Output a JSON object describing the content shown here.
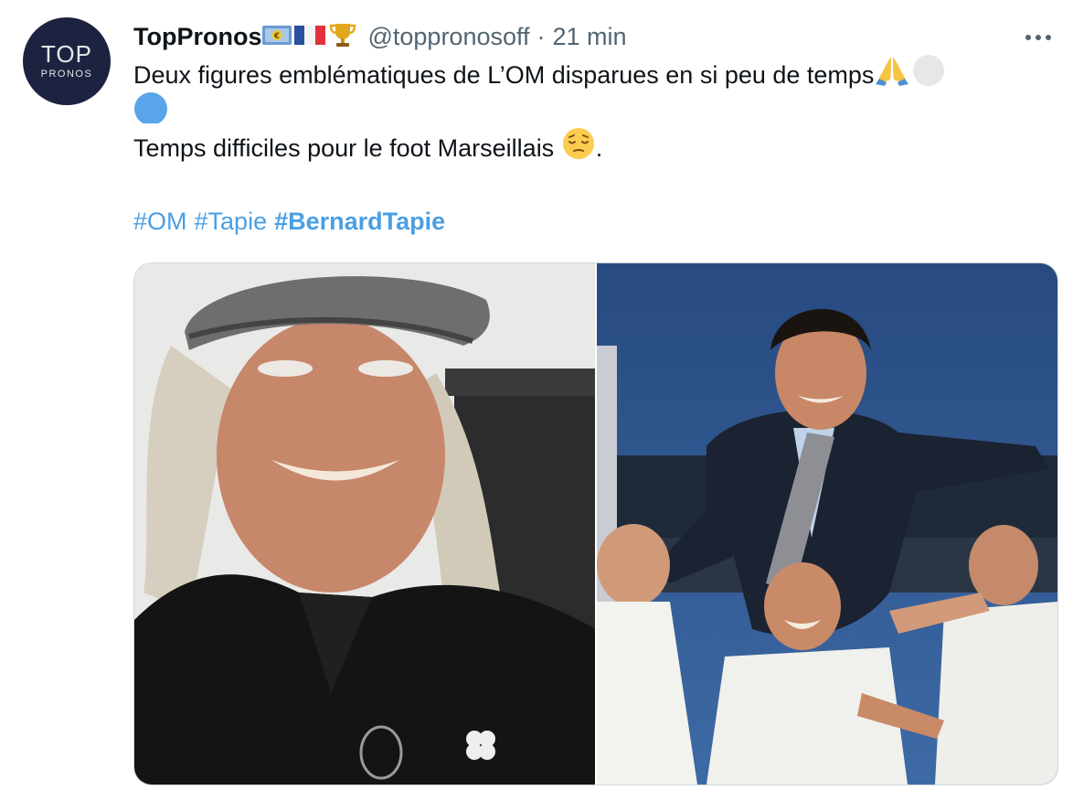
{
  "author": {
    "avatar_line1": "TOP",
    "avatar_line2": "PRONOS",
    "display_name": "TopPronos",
    "handle": "@toppronosoff",
    "separator": "·",
    "time": "21 min"
  },
  "tweet": {
    "line1": "Deux figures emblématiques de L’OM disparues en si peu de temps",
    "line3_text": "Temps difficiles pour le foot Marseillais ",
    "line3_end": ".",
    "hashtags": [
      {
        "label": "#OM",
        "bold": false
      },
      {
        "label": "#Tapie",
        "bold": false
      },
      {
        "label": "#BernardTapie",
        "bold": true
      }
    ]
  },
  "icons": {
    "name_emojis": [
      "euro-banknote-icon",
      "france-flag-icon",
      "trophy-icon"
    ],
    "line1_emojis": [
      "folded-hands-icon",
      "white-circle-icon"
    ],
    "line2_emojis": [
      "blue-circle-icon"
    ],
    "line3_emojis": [
      "pensive-face-icon"
    ],
    "more": "more-dots-icon"
  },
  "colors": {
    "text": "#0f1419",
    "secondary": "#536471",
    "hashtag": "#4a9fe3",
    "avatar_bg": "#1c2240",
    "media_border": "#cfd9de"
  },
  "media": {
    "photos": [
      "photo-man-with-flat-cap",
      "photo-man-carried-by-players"
    ]
  }
}
